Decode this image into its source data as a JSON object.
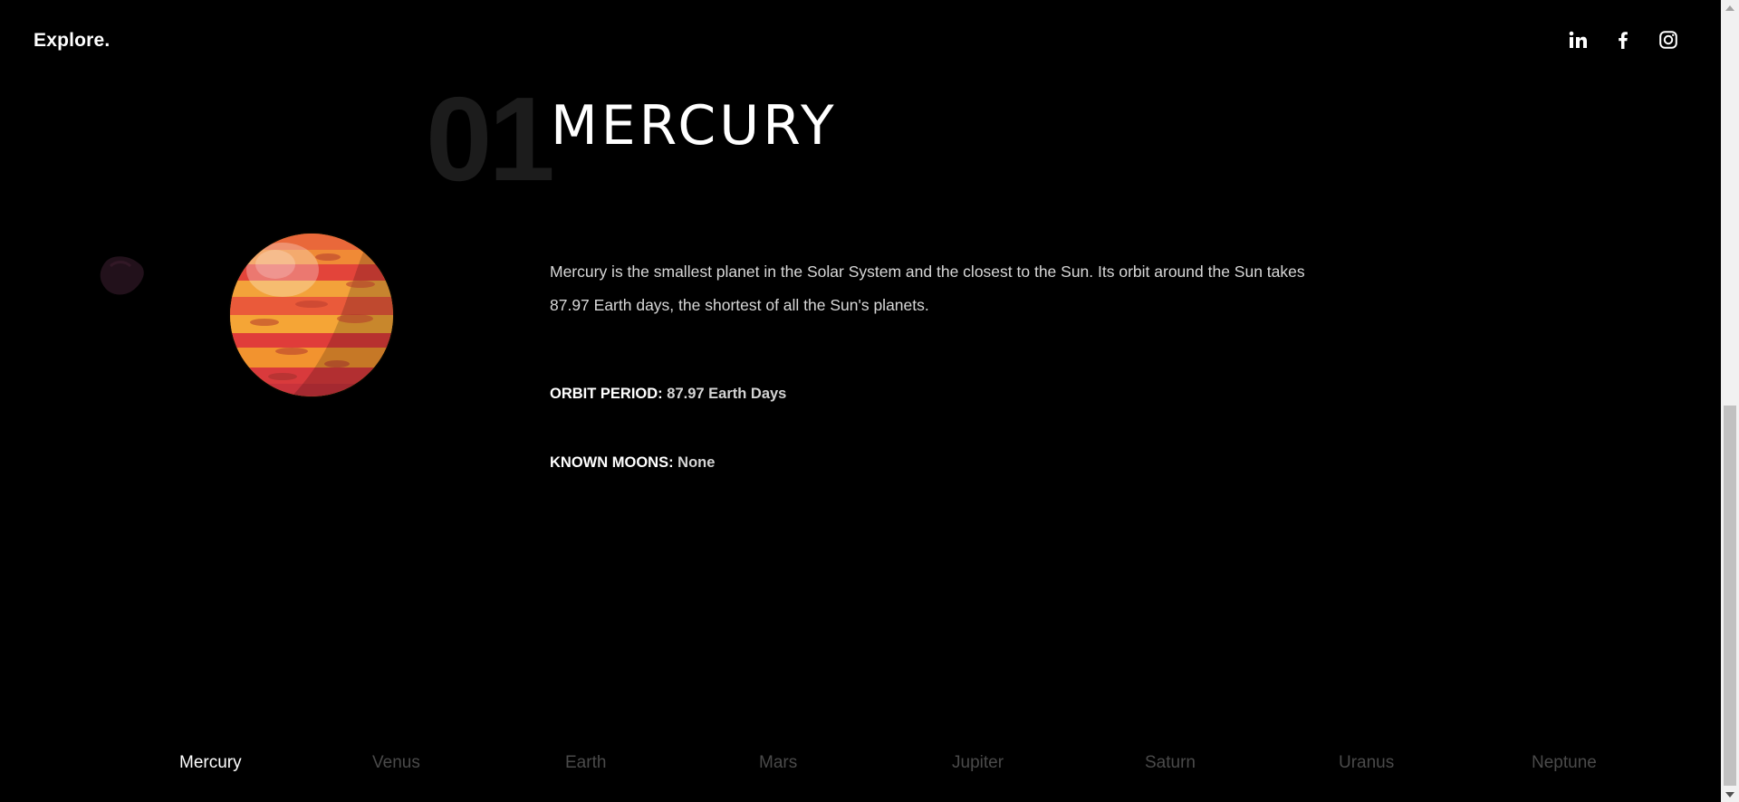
{
  "header": {
    "brand": "Explore.",
    "socials": [
      {
        "icon": "linkedin-icon",
        "label": "in"
      },
      {
        "icon": "facebook-icon",
        "label": "f"
      },
      {
        "icon": "instagram-icon",
        "label": ""
      }
    ]
  },
  "planet": {
    "number": "01",
    "name": "MERCURY",
    "description": "Mercury is the smallest planet in the Solar System and the closest to the Sun. Its orbit around the Sun takes 87.97 Earth days, the shortest of all the Sun's planets.",
    "orbit_label": "ORBIT PERIOD:",
    "orbit_value": "87.97 Earth Days",
    "moons_label": "KNOWN MOONS:",
    "moons_value": "None"
  },
  "nav": {
    "items": [
      {
        "label": "Mercury",
        "active": true
      },
      {
        "label": "Venus",
        "active": false
      },
      {
        "label": "Earth",
        "active": false
      },
      {
        "label": "Mars",
        "active": false
      },
      {
        "label": "Jupiter",
        "active": false
      },
      {
        "label": "Saturn",
        "active": false
      },
      {
        "label": "Uranus",
        "active": false
      },
      {
        "label": "Neptune",
        "active": false
      }
    ]
  },
  "colors": {
    "background": "#000000",
    "text": "#ffffff",
    "muted": "#4a4a4a",
    "planet_orange": "#f39a2b",
    "planet_red": "#e2463a"
  }
}
